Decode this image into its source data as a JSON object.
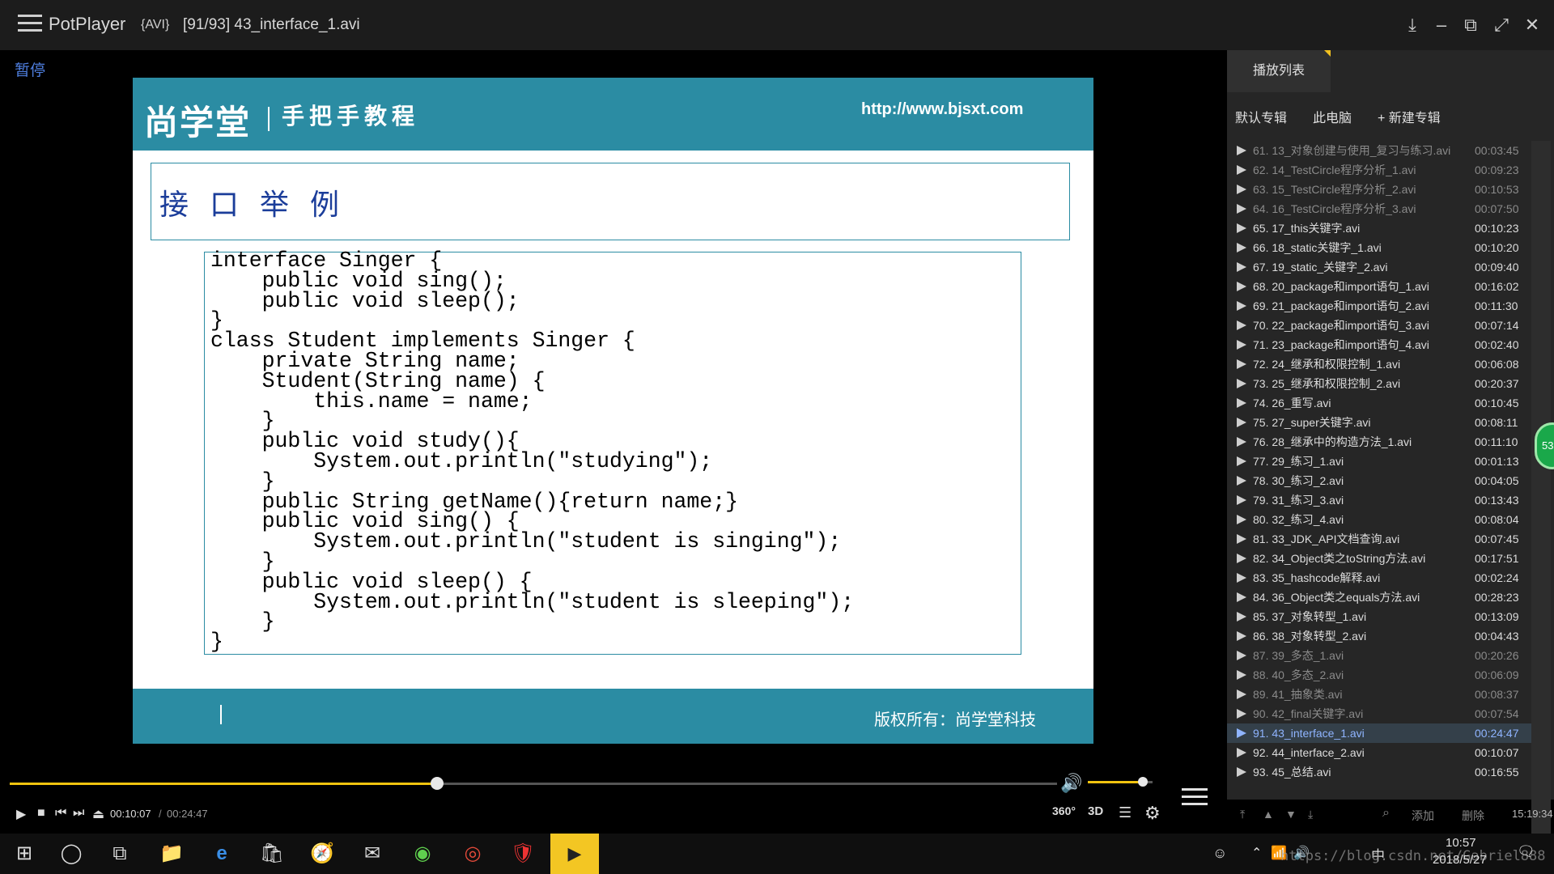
{
  "titlebar": {
    "app_name": "PotPlayer",
    "format": "{AVI}",
    "file": "[91/93] 43_interface_1.avi"
  },
  "player": {
    "pause_label": "暂停",
    "current_time": "00:10:07",
    "separator": "/",
    "total_time": "00:24:47",
    "progress": 0.408,
    "volume": 0.85,
    "btn_360": "360°",
    "btn_3d": "3D"
  },
  "slide": {
    "logo": "尚学堂",
    "slogan": "手把手教程",
    "url": "http://www.bjsxt.com",
    "heading": "接口举例",
    "code": "interface Singer {\n    public void sing();\n    public void sleep();\n}\nclass Student implements Singer {\n    private String name;\n    Student(String name) {\n        this.name = name;\n    }\n    public void study(){\n        System.out.println(\"studying\");\n    }\n    public String getName(){return name;}\n    public void sing() {\n        System.out.println(\"student is singing\");\n    }\n    public void sleep() {\n        System.out.println(\"student is sleeping\");\n    }\n}",
    "copyright": "版权所有：尚学堂科技"
  },
  "playlist": {
    "tab": "播放列表",
    "albums": [
      "默认专辑",
      "此电脑",
      "+ 新建专辑"
    ],
    "items": [
      {
        "name": "61. 13_对象创建与使用_复习与练习.avi",
        "dur": "00:03:45",
        "state": "dim"
      },
      {
        "name": "62. 14_TestCircle程序分析_1.avi",
        "dur": "00:09:23",
        "state": "dim"
      },
      {
        "name": "63. 15_TestCircle程序分析_2.avi",
        "dur": "00:10:53",
        "state": "dim"
      },
      {
        "name": "64. 16_TestCircle程序分析_3.avi",
        "dur": "00:07:50",
        "state": "dim"
      },
      {
        "name": "65. 17_this关键字.avi",
        "dur": "00:10:23",
        "state": ""
      },
      {
        "name": "66. 18_static关键字_1.avi",
        "dur": "00:10:20",
        "state": ""
      },
      {
        "name": "67. 19_static_关键字_2.avi",
        "dur": "00:09:40",
        "state": ""
      },
      {
        "name": "68. 20_package和import语句_1.avi",
        "dur": "00:16:02",
        "state": ""
      },
      {
        "name": "69. 21_package和import语句_2.avi",
        "dur": "00:11:30",
        "state": ""
      },
      {
        "name": "70. 22_package和import语句_3.avi",
        "dur": "00:07:14",
        "state": ""
      },
      {
        "name": "71. 23_package和import语句_4.avi",
        "dur": "00:02:40",
        "state": ""
      },
      {
        "name": "72. 24_继承和权限控制_1.avi",
        "dur": "00:06:08",
        "state": ""
      },
      {
        "name": "73. 25_继承和权限控制_2.avi",
        "dur": "00:20:37",
        "state": ""
      },
      {
        "name": "74. 26_重写.avi",
        "dur": "00:10:45",
        "state": ""
      },
      {
        "name": "75. 27_super关键字.avi",
        "dur": "00:08:11",
        "state": ""
      },
      {
        "name": "76. 28_继承中的构造方法_1.avi",
        "dur": "00:11:10",
        "state": ""
      },
      {
        "name": "77. 29_练习_1.avi",
        "dur": "00:01:13",
        "state": ""
      },
      {
        "name": "78. 30_练习_2.avi",
        "dur": "00:04:05",
        "state": ""
      },
      {
        "name": "79. 31_练习_3.avi",
        "dur": "00:13:43",
        "state": ""
      },
      {
        "name": "80. 32_练习_4.avi",
        "dur": "00:08:04",
        "state": ""
      },
      {
        "name": "81. 33_JDK_API文档查询.avi",
        "dur": "00:07:45",
        "state": ""
      },
      {
        "name": "82. 34_Object类之toString方法.avi",
        "dur": "00:17:51",
        "state": ""
      },
      {
        "name": "83. 35_hashcode解释.avi",
        "dur": "00:02:24",
        "state": ""
      },
      {
        "name": "84. 36_Object类之equals方法.avi",
        "dur": "00:28:23",
        "state": ""
      },
      {
        "name": "85. 37_对象转型_1.avi",
        "dur": "00:13:09",
        "state": ""
      },
      {
        "name": "86. 38_对象转型_2.avi",
        "dur": "00:04:43",
        "state": ""
      },
      {
        "name": "87. 39_多态_1.avi",
        "dur": "00:20:26",
        "state": "dim"
      },
      {
        "name": "88. 40_多态_2.avi",
        "dur": "00:06:09",
        "state": "dim"
      },
      {
        "name": "89. 41_抽象类.avi",
        "dur": "00:08:37",
        "state": "dim"
      },
      {
        "name": "90. 42_final关键字.avi",
        "dur": "00:07:54",
        "state": "dim"
      },
      {
        "name": "91. 43_interface_1.avi",
        "dur": "00:24:47",
        "state": "active"
      },
      {
        "name": "92. 44_interface_2.avi",
        "dur": "00:10:07",
        "state": ""
      },
      {
        "name": "93. 45_总结.avi",
        "dur": "00:16:55",
        "state": ""
      }
    ],
    "add_label": "添加",
    "delete_label": "删除",
    "total_duration": "15:19:34"
  },
  "badge": "53",
  "taskbar": {
    "ime": "中",
    "time": "10:57",
    "date": "2018/5/27",
    "watermark": "https://blog.csdn.net/Gabriel888"
  },
  "colors": {
    "accent": "#f1c40f",
    "slide_teal": "#2b8ca3",
    "heading_blue": "#1b3d9a"
  }
}
